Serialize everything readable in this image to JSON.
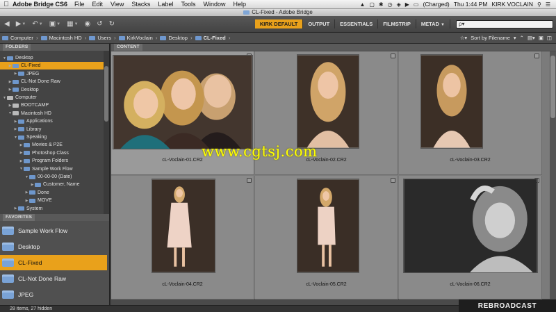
{
  "menubar": {
    "app_name": "Adobe Bridge CS6",
    "items": [
      "File",
      "Edit",
      "View",
      "Stacks",
      "Label",
      "Tools",
      "Window",
      "Help"
    ],
    "battery": "(Charged)",
    "clock": "Thu 1:44 PM",
    "user": "KIRK VOCLAIN"
  },
  "window": {
    "title": "CL-Fixed - Adobe Bridge"
  },
  "toolbar": {
    "workspaces": [
      "KIRK DEFAULT",
      "OUTPUT",
      "ESSENTIALS",
      "FILMSTRIP",
      "METAD"
    ],
    "search_value": "ρ▾"
  },
  "path": {
    "crumbs": [
      "Computer",
      "Macintosh HD",
      "Users",
      "KirkVoclain",
      "Desktop",
      "CL-Fixed"
    ],
    "sort_label": "Sort by Filename"
  },
  "panels": {
    "folders_tab": "FOLDERS",
    "favorites_tab": "FAVORITES",
    "content_tab": "CONTENT"
  },
  "folders": [
    {
      "label": "Desktop",
      "level": 0
    },
    {
      "label": "CL-Fixed",
      "level": 1
    },
    {
      "label": "JPEG",
      "level": 2
    },
    {
      "label": "CL-Not Done Raw",
      "level": 1
    },
    {
      "label": "Desktop",
      "level": 1
    },
    {
      "label": "Computer",
      "level": 0
    },
    {
      "label": "BOOTCAMP",
      "level": 1
    },
    {
      "label": "Macintosh HD",
      "level": 1
    },
    {
      "label": "Applications",
      "level": 2
    },
    {
      "label": "Library",
      "level": 2
    },
    {
      "label": "Speaking",
      "level": 2
    },
    {
      "label": "Movies & P2E",
      "level": 3
    },
    {
      "label": "Photoshop Class",
      "level": 3
    },
    {
      "label": "Program Folders",
      "level": 3
    },
    {
      "label": "Sample Work Flow",
      "level": 3
    },
    {
      "label": "00-00-00 (Date)",
      "level": 4
    },
    {
      "label": "Customer, Name",
      "level": 5
    },
    {
      "label": "Done",
      "level": 4
    },
    {
      "label": "MOVE",
      "level": 4
    },
    {
      "label": "System",
      "level": 2
    }
  ],
  "favorites": [
    "Sample Work Flow",
    "Desktop",
    "CL-Fixed",
    "CL-Not Done Raw",
    "JPEG"
  ],
  "thumbnails": [
    "cL-Voclain-01.CR2",
    "cL-Voclain-02.CR2",
    "cL-Voclain-03.CR2",
    "cL-Voclain-04.CR2",
    "cL-Voclain-05.CR2",
    "cL-Voclain-06.CR2"
  ],
  "status": {
    "text": "28 items, 27 hidden"
  },
  "overlays": {
    "watermark": "www.cgtsj.com",
    "rebroadcast": "REBROADCAST"
  },
  "colors": {
    "accent": "#e9a11b",
    "watermark": "#ffff00"
  },
  "icons": [
    "back-icon",
    "forward-icon",
    "boomerang-icon",
    "camera-icon",
    "refine-icon",
    "open-in-camera-raw-icon",
    "rotate-left-icon",
    "rotate-right-icon",
    "star-icon",
    "new-folder-icon",
    "trash-icon",
    "search-icon"
  ]
}
